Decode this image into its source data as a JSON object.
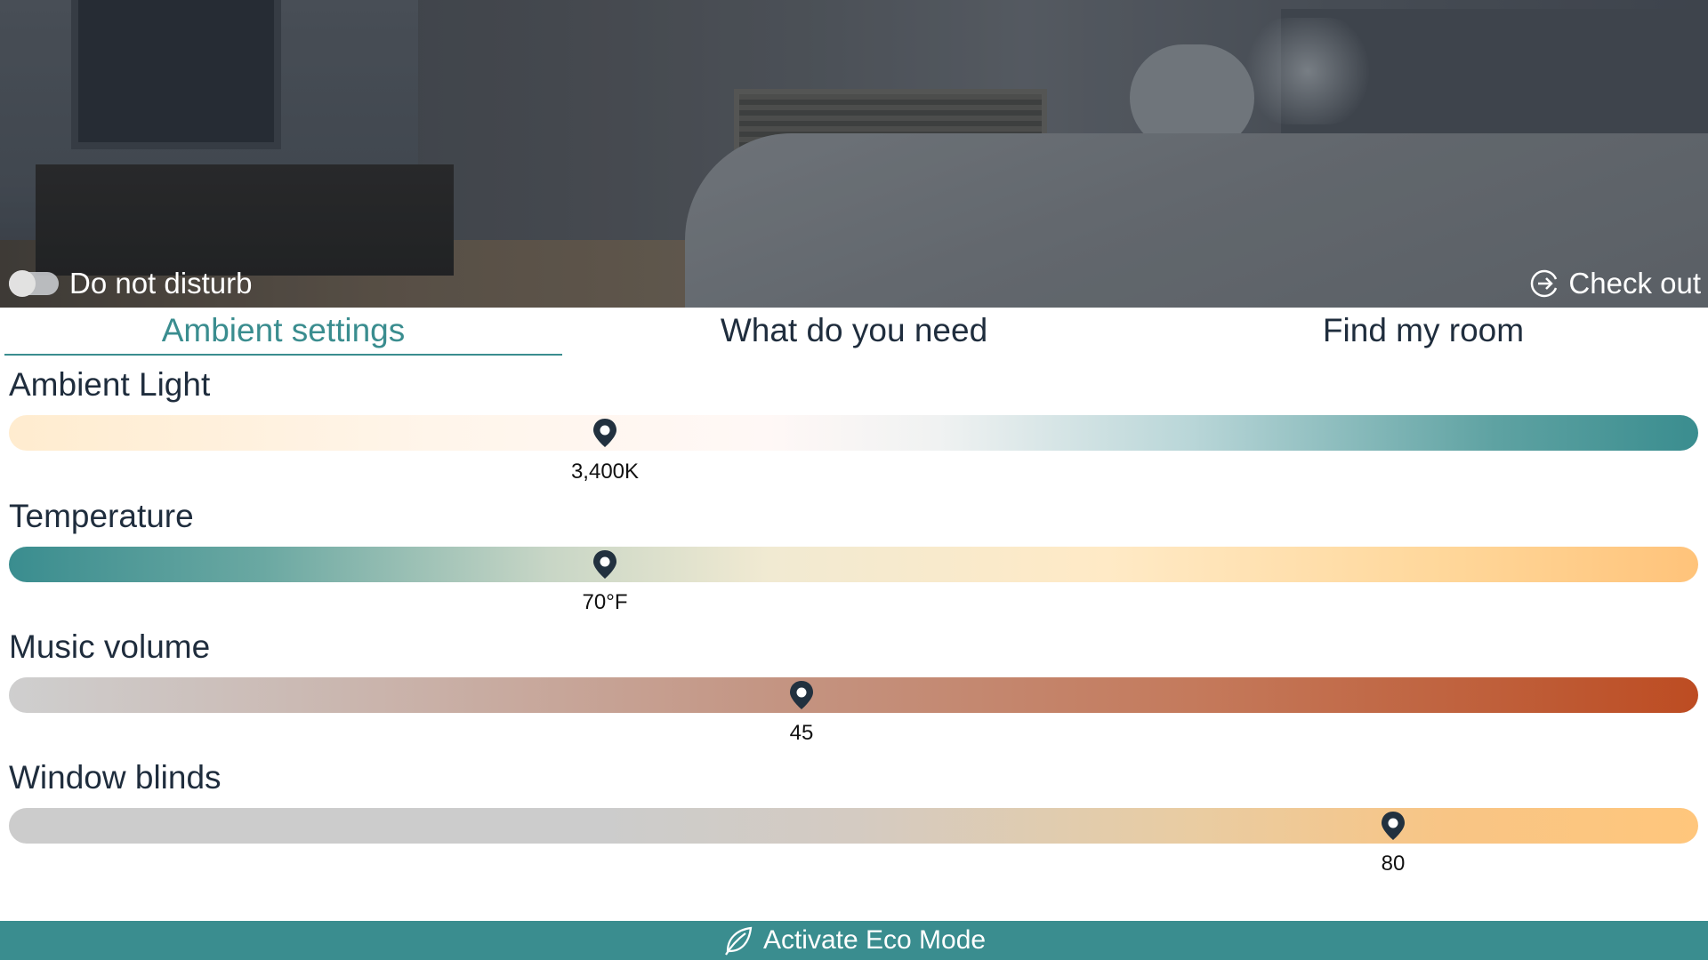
{
  "header": {
    "do_not_disturb": {
      "label": "Do not disturb",
      "enabled": false
    },
    "checkout": {
      "label": "Check out",
      "icon": "logout-arrow-icon"
    }
  },
  "tabs": [
    {
      "label": "Ambient settings",
      "active": true
    },
    {
      "label": "What do you need",
      "active": false
    },
    {
      "label": "Find my room",
      "active": false
    }
  ],
  "settings": [
    {
      "title": "Ambient Light",
      "value_label": "3,400K",
      "position_fraction": 0.352
    },
    {
      "title": "Temperature",
      "value_label": "70°F",
      "position_fraction": 0.352
    },
    {
      "title": "Music volume",
      "value_label": "45",
      "position_fraction": 0.468
    },
    {
      "title": "Window blinds",
      "value_label": "80",
      "position_fraction": 0.82
    }
  ],
  "eco": {
    "label": "Activate Eco Mode",
    "icon": "leaf-icon"
  },
  "colors": {
    "accent": "#3a8d8f",
    "pin": "#22313f",
    "text": "#1f2d3d"
  }
}
